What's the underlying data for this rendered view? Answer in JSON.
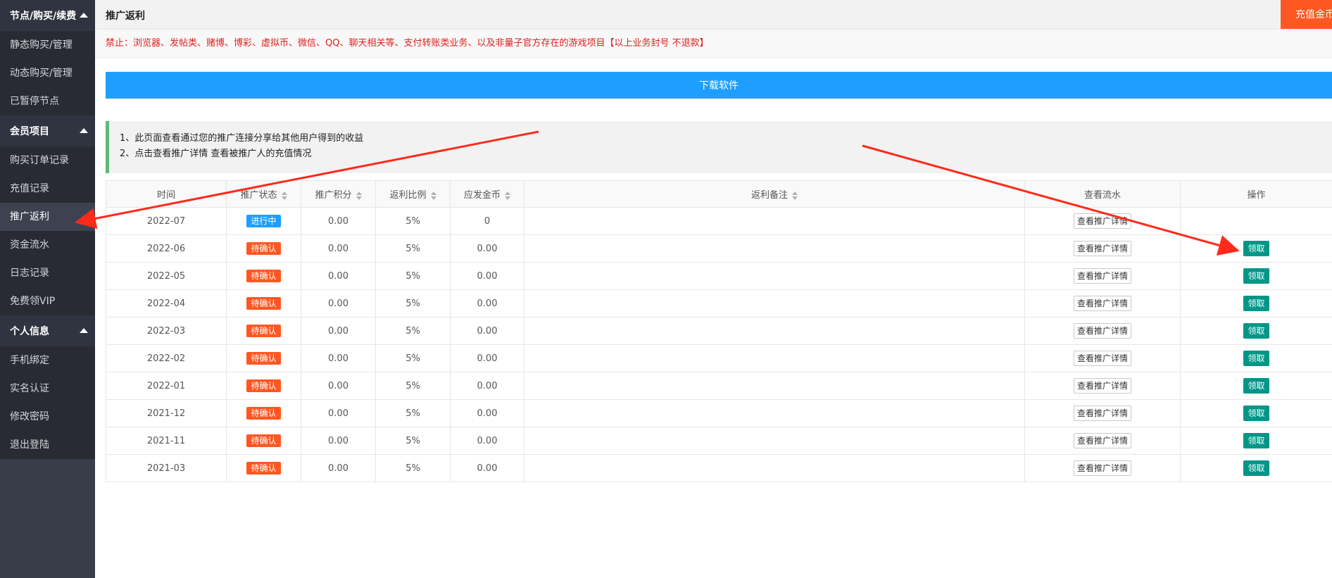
{
  "sidebar": {
    "groups": [
      {
        "title": "节点/购买/续费",
        "items": [
          "静态购买/管理",
          "动态购买/管理",
          "已暂停节点"
        ]
      },
      {
        "title": "会员项目",
        "items": [
          "购买订单记录",
          "充值记录",
          "推广返利",
          "资金流水",
          "日志记录",
          "免费领VIP"
        ]
      },
      {
        "title": "个人信息",
        "items": [
          "手机绑定",
          "实名认证",
          "修改密码",
          "退出登陆"
        ]
      }
    ]
  },
  "header": {
    "title": "推广返利",
    "recharge_label": "充值金币"
  },
  "notice": "禁止：浏览器、发帖类、赌博、博彩、虚拟币、微信、QQ、聊天相关等、支付转账类业务、以及非量子官方存在的游戏项目【以上业务封号 不退款】",
  "download_label": "下载软件",
  "tips": [
    "1、此页面查看通过您的推广连接分享给其他用户得到的收益",
    "2、点击查看推广详情 查看被推广人的充值情况"
  ],
  "table": {
    "headers": [
      "时间",
      "推广状态",
      "推广积分",
      "返利比例",
      "应发金币",
      "返利备注",
      "查看流水",
      "操作"
    ],
    "detail_label": "查看推广详情",
    "claim_label": "领取",
    "rows": [
      {
        "time": "2022-07",
        "status": "进行中",
        "points": "0.00",
        "ratio": "5%",
        "coins": "0",
        "note": "",
        "claim": false
      },
      {
        "time": "2022-06",
        "status": "待确认",
        "points": "0.00",
        "ratio": "5%",
        "coins": "0.00",
        "note": "",
        "claim": true
      },
      {
        "time": "2022-05",
        "status": "待确认",
        "points": "0.00",
        "ratio": "5%",
        "coins": "0.00",
        "note": "",
        "claim": true
      },
      {
        "time": "2022-04",
        "status": "待确认",
        "points": "0.00",
        "ratio": "5%",
        "coins": "0.00",
        "note": "",
        "claim": true
      },
      {
        "time": "2022-03",
        "status": "待确认",
        "points": "0.00",
        "ratio": "5%",
        "coins": "0.00",
        "note": "",
        "claim": true
      },
      {
        "time": "2022-02",
        "status": "待确认",
        "points": "0.00",
        "ratio": "5%",
        "coins": "0.00",
        "note": "",
        "claim": true
      },
      {
        "time": "2022-01",
        "status": "待确认",
        "points": "0.00",
        "ratio": "5%",
        "coins": "0.00",
        "note": "",
        "claim": true
      },
      {
        "time": "2021-12",
        "status": "待确认",
        "points": "0.00",
        "ratio": "5%",
        "coins": "0.00",
        "note": "",
        "claim": true
      },
      {
        "time": "2021-11",
        "status": "待确认",
        "points": "0.00",
        "ratio": "5%",
        "coins": "0.00",
        "note": "",
        "claim": true
      },
      {
        "time": "2021-03",
        "status": "待确认",
        "points": "0.00",
        "ratio": "5%",
        "coins": "0.00",
        "note": "",
        "claim": true
      }
    ]
  },
  "colors": {
    "sidebar_bg": "#393d49",
    "accent_blue": "#1e9fff",
    "accent_orange": "#ff5722",
    "accent_teal": "#009688",
    "annotation_red": "#ff2a1a"
  }
}
